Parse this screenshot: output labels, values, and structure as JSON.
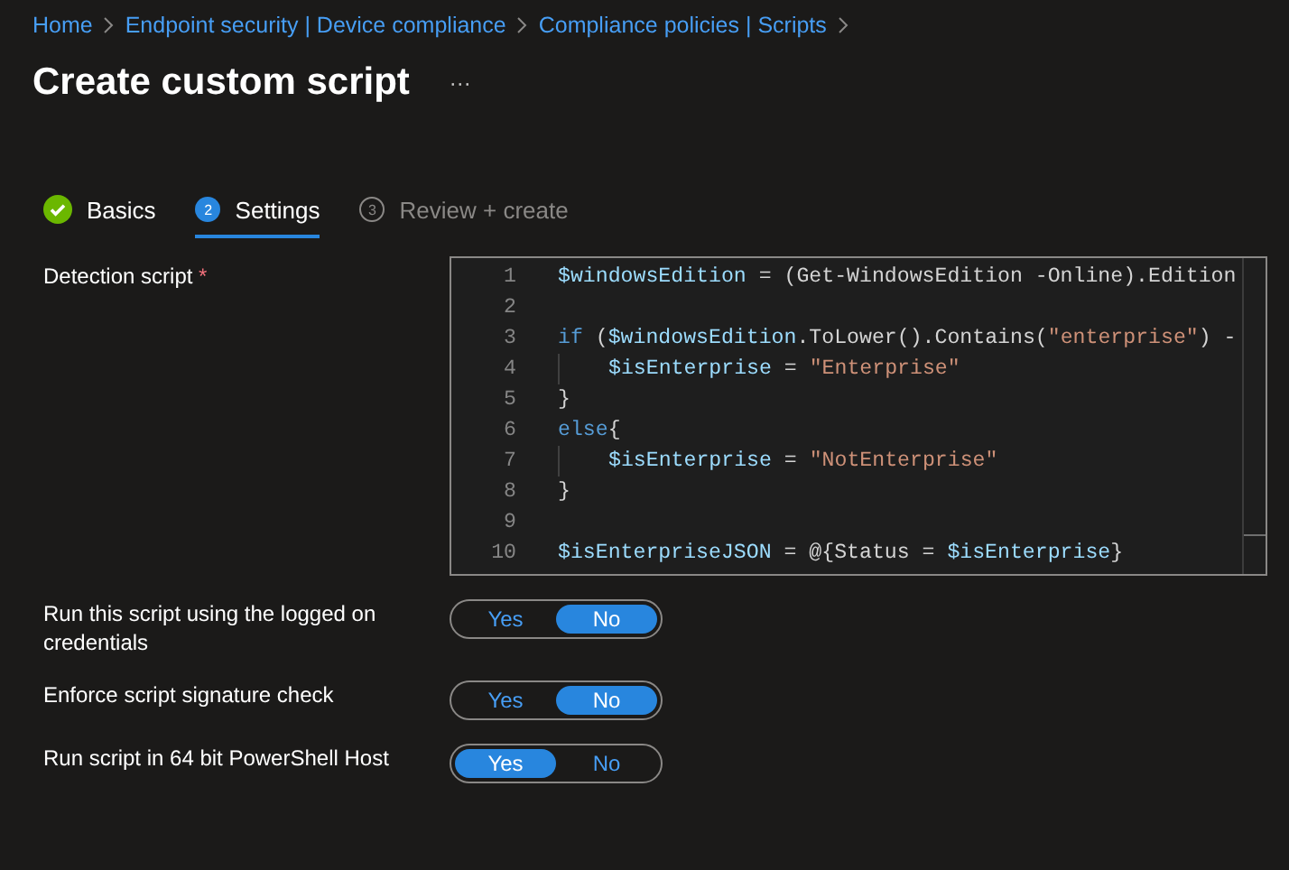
{
  "breadcrumb": [
    "Home",
    "Endpoint security | Device compliance",
    "Compliance policies | Scripts"
  ],
  "title": "Create custom script",
  "more": "···",
  "tabs": [
    {
      "label": "Basics",
      "kind": "done",
      "selected": false
    },
    {
      "label": "Settings",
      "number": "2",
      "kind": "current",
      "selected": true
    },
    {
      "label": "Review + create",
      "number": "3",
      "kind": "pending",
      "selected": false
    }
  ],
  "detection": {
    "label": "Detection script",
    "required": "*",
    "lines": [
      {
        "number": "1",
        "tokens": [
          {
            "kind": "var",
            "text": "$windowsEdition"
          },
          {
            "kind": "plain",
            "text": " = (Get-WindowsEdition -Online).Edition"
          }
        ]
      },
      {
        "number": "2"
      },
      {
        "number": "3",
        "tokens": [
          {
            "kind": "keyword",
            "text": "if"
          },
          {
            "kind": "plain",
            "text": " ("
          },
          {
            "kind": "var",
            "text": "$windowsEdition"
          },
          {
            "kind": "plain",
            "text": ".ToLower().Contains("
          },
          {
            "kind": "string",
            "text": "\"enterprise\""
          },
          {
            "kind": "plain",
            "text": ") -"
          }
        ]
      },
      {
        "number": "4",
        "indent": true,
        "tokens": [
          {
            "kind": "var",
            "text": "$isEnterprise"
          },
          {
            "kind": "plain",
            "text": " = "
          },
          {
            "kind": "string",
            "text": "\"Enterprise\""
          }
        ]
      },
      {
        "number": "5",
        "tokens": [
          {
            "kind": "plain",
            "text": "}"
          }
        ]
      },
      {
        "number": "6",
        "tokens": [
          {
            "kind": "keyword",
            "text": "else"
          },
          {
            "kind": "plain",
            "text": "{"
          }
        ]
      },
      {
        "number": "7",
        "indent": true,
        "tokens": [
          {
            "kind": "var",
            "text": "$isEnterprise"
          },
          {
            "kind": "plain",
            "text": " = "
          },
          {
            "kind": "string",
            "text": "\"NotEnterprise\""
          }
        ]
      },
      {
        "number": "8",
        "tokens": [
          {
            "kind": "plain",
            "text": "}"
          }
        ]
      },
      {
        "number": "9"
      },
      {
        "number": "10",
        "tokens": [
          {
            "kind": "var",
            "text": "$isEnterpriseJSON"
          },
          {
            "kind": "plain",
            "text": " = @{Status = "
          },
          {
            "kind": "var",
            "text": "$isEnterprise"
          },
          {
            "kind": "plain",
            "text": "}"
          }
        ]
      }
    ]
  },
  "settings": [
    {
      "label": "Run this script using the logged on credentials",
      "options": [
        {
          "label": "Yes",
          "selected": false
        },
        {
          "label": "No",
          "selected": true
        }
      ]
    },
    {
      "label": "Enforce script signature check",
      "options": [
        {
          "label": "Yes",
          "selected": false
        },
        {
          "label": "No",
          "selected": true
        }
      ]
    },
    {
      "label": "Run script in 64 bit PowerShell Host",
      "options": [
        {
          "label": "Yes",
          "selected": true
        },
        {
          "label": "No",
          "selected": false
        }
      ]
    }
  ]
}
